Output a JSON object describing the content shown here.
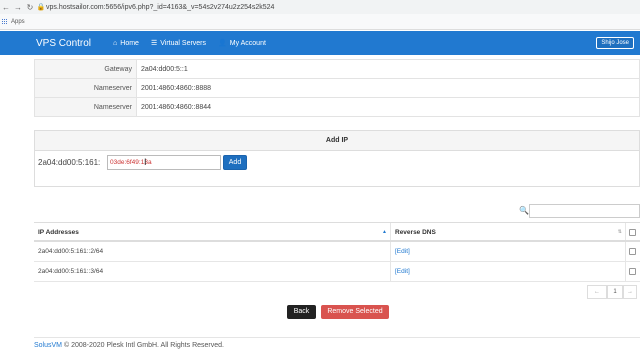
{
  "browser": {
    "url": "vps.hostsailor.com:5656/ipv6.php?_id=4163&_v=54s2v274u2z254s2k524",
    "bookmarks": {
      "apps_label": "Apps"
    }
  },
  "navbar": {
    "brand": "VPS Control",
    "links": [
      {
        "label": "Home",
        "icon": "home-icon"
      },
      {
        "label": "Virtual Servers",
        "icon": "list-icon"
      },
      {
        "label": "My Account",
        "icon": "user-icon"
      }
    ],
    "user": "Shijo Jose"
  },
  "info": [
    {
      "label": "Gateway",
      "value": "2a04:dd00:5::1"
    },
    {
      "label": "Nameserver",
      "value": "2001:4860:4860::8888"
    },
    {
      "label": "Nameserver",
      "value": "2001:4860:4860::8844"
    }
  ],
  "add_ip": {
    "heading": "Add IP",
    "prefix": "2a04:dd00:5:161:",
    "input_value": "03de:6f49:13a",
    "button": "Add"
  },
  "table": {
    "headers": {
      "ip": "IP Addresses",
      "dns": "Reverse DNS"
    },
    "rows": [
      {
        "ip": "2a04:dd00:5:161::2/64",
        "dns": "[Edit]"
      },
      {
        "ip": "2a04:dd00:5:161::3/64",
        "dns": "[Edit]"
      }
    ]
  },
  "pagination": {
    "prev": "←",
    "current": "1",
    "next": "→"
  },
  "actions": {
    "back": "Back",
    "remove": "Remove Selected"
  },
  "footer": {
    "brand": "SolusVM",
    "text": " © 2008-2020 Plesk Intl GmbH. All Rights Reserved."
  }
}
